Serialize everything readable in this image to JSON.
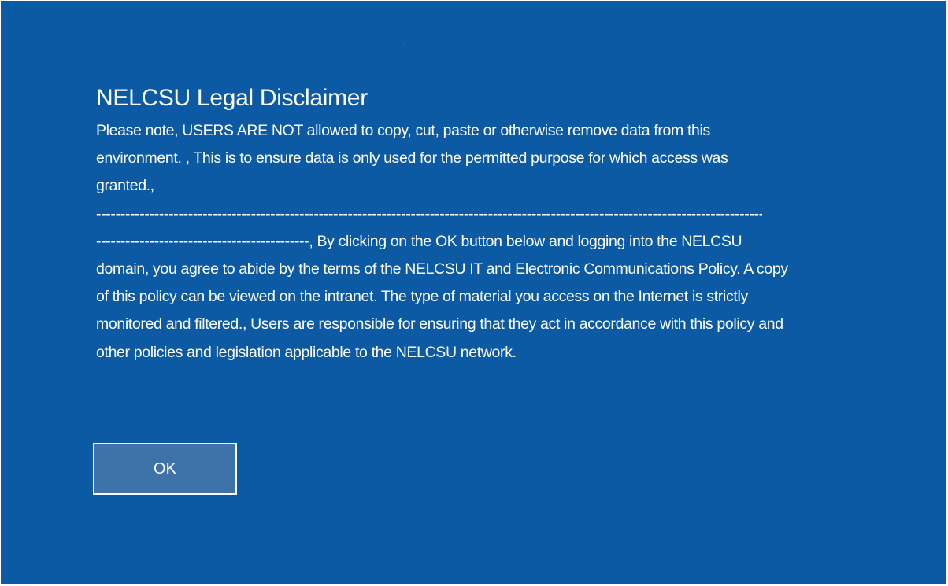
{
  "disclaimer": {
    "title": "NELCSU Legal Disclaimer",
    "paragraph_1": "Please note, USERS ARE NOT allowed to copy, cut, paste or otherwise remove data from this environment. , This is to ensure data is only used for the permitted purpose for which access was granted.,",
    "separator": "------------------------------------------------------------------------------------------------------------------------------------------------",
    "paragraph_2": "--------------------------------------------, By clicking on the OK button below and logging into the NELCSU domain, you agree to abide by the terms of the NELCSU IT and Electronic Communications Policy. A copy of this policy can be viewed on the intranet. The type of material you access on the Internet is strictly monitored and filtered., Users are responsible for ensuring that they act in accordance with this policy and other policies and legislation applicable to the NELCSU network.",
    "ok_label": "OK"
  },
  "colors": {
    "background": "#0c5aa3",
    "button_fill": "#3d73a9",
    "text": "#ffffff"
  }
}
